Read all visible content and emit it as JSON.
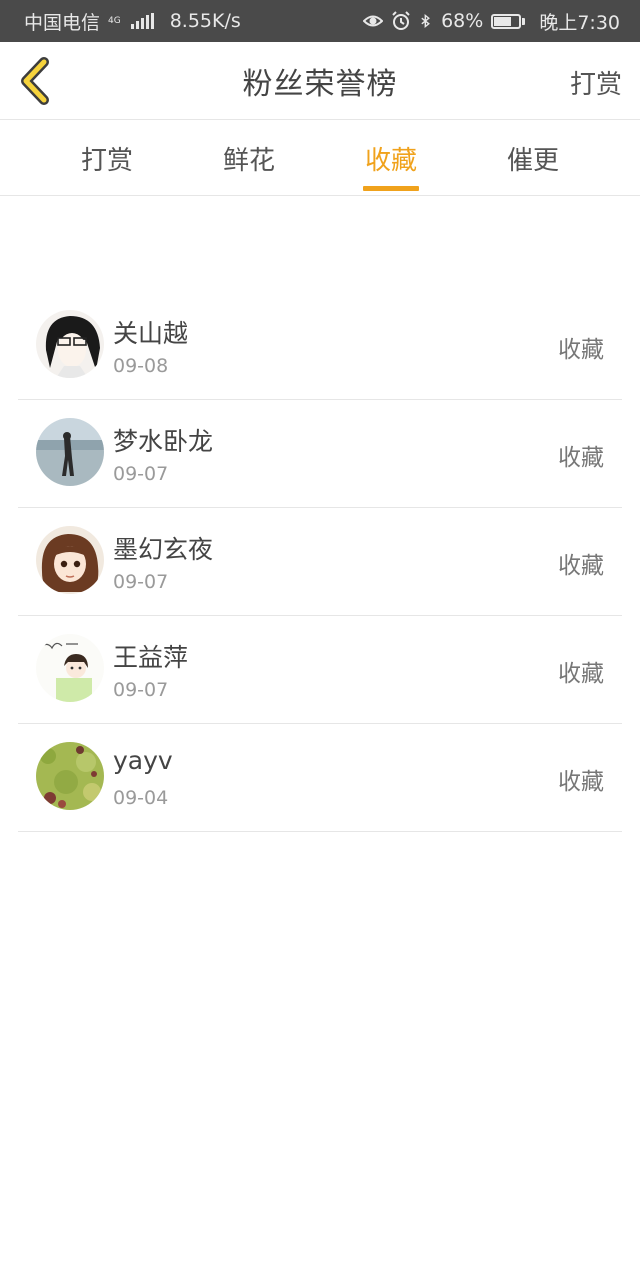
{
  "status_bar": {
    "carrier": "中国电信",
    "network_type": "4G",
    "speed": "8.55K/s",
    "battery": "68%",
    "battery_level": 0.68,
    "time": "晚上7:30",
    "icons": [
      "signal-icon",
      "eye-icon",
      "alarm-icon",
      "bluetooth-icon",
      "battery-icon"
    ]
  },
  "header": {
    "title": "粉丝荣誉榜",
    "action_label": "打赏",
    "back_icon": "chevron-left-icon",
    "accent_color": "#f0a21c"
  },
  "tabs": [
    {
      "label": "打赏",
      "active": false
    },
    {
      "label": "鲜花",
      "active": false
    },
    {
      "label": "收藏",
      "active": true
    },
    {
      "label": "催更",
      "active": false
    }
  ],
  "list": [
    {
      "name": "关山越",
      "date": "09-08",
      "action": "收藏",
      "avatar": "anime-boy-glasses"
    },
    {
      "name": "梦水卧龙",
      "date": "09-07",
      "action": "收藏",
      "avatar": "person-by-lake"
    },
    {
      "name": "墨幻玄夜",
      "date": "09-07",
      "action": "收藏",
      "avatar": "anime-girl-ponytail"
    },
    {
      "name": "王益萍",
      "date": "09-07",
      "action": "收藏",
      "avatar": "girl-sketch-green"
    },
    {
      "name": "yayv",
      "date": "09-04",
      "action": "收藏",
      "avatar": "green-meadow"
    }
  ]
}
